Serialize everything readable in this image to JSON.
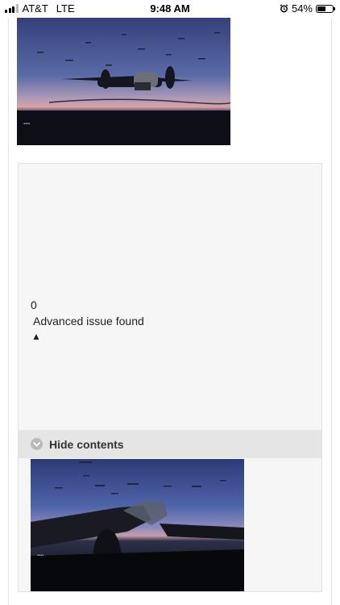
{
  "status_bar": {
    "carrier": "AT&T",
    "network": "LTE",
    "time": "9:48 AM",
    "battery": "54%",
    "battery_level": 0.54,
    "icons": [
      "signal-icon",
      "alarm-icon",
      "battery-icon"
    ]
  },
  "issue": {
    "count": "0",
    "text": "Advanced issue found",
    "arrow": "▲"
  },
  "spoiler": {
    "label": "Hide contents",
    "icon": "chevron-down-icon"
  },
  "images": [
    {
      "name": "screenshot-bomber-dusk",
      "icon": "image"
    },
    {
      "name": "screenshot-bomber-cockpit-view",
      "icon": "image"
    }
  ],
  "colors": {
    "hide_bar_bg": "#e5e5e5",
    "box_bg": "#f6f6f6"
  }
}
